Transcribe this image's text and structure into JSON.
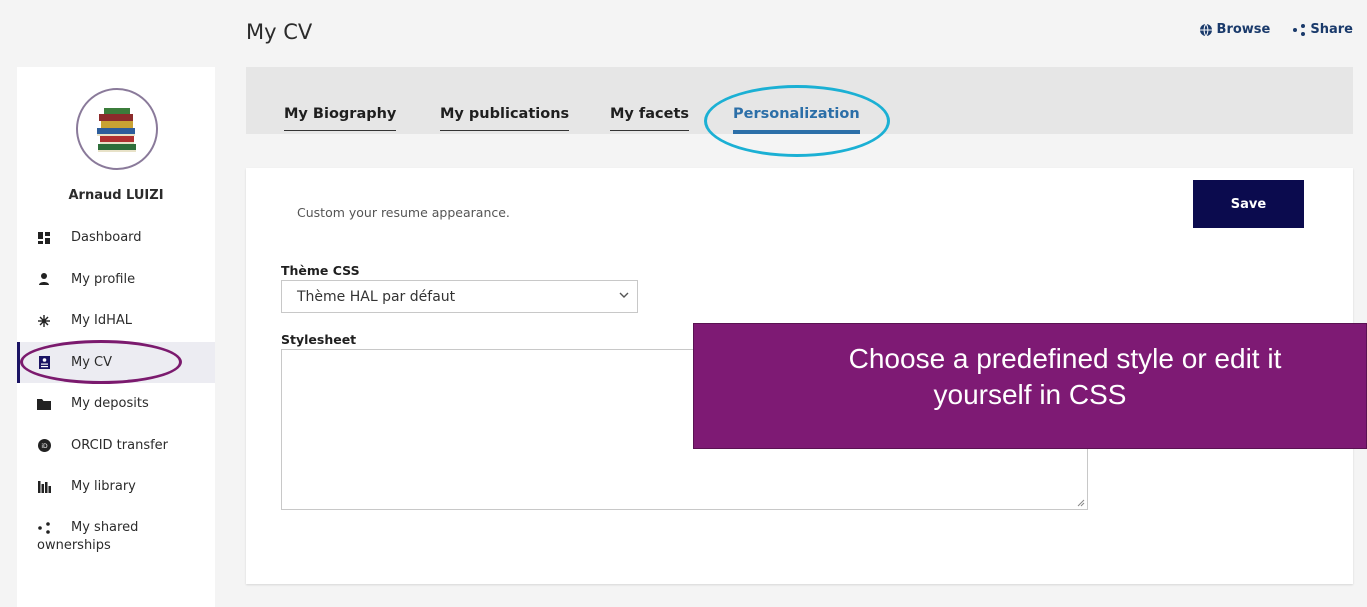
{
  "page": {
    "title": "My CV"
  },
  "top_actions": [
    {
      "label": "Browse",
      "icon": "globe-icon"
    },
    {
      "label": "Share",
      "icon": "share-icon"
    }
  ],
  "user": {
    "name": "Arnaud LUIZI",
    "avatar_icon": "books-icon"
  },
  "sidebar": {
    "items": [
      {
        "label": "Dashboard",
        "icon": "dashboard-icon"
      },
      {
        "label": "My profile",
        "icon": "person-icon"
      },
      {
        "label": "My IdHAL",
        "icon": "idhal-icon"
      },
      {
        "label": "My CV",
        "icon": "cv-icon",
        "active": true
      },
      {
        "label": "My deposits",
        "icon": "folder-icon"
      },
      {
        "label": "ORCID transfer",
        "icon": "orcid-icon"
      },
      {
        "label": "My library",
        "icon": "library-icon"
      },
      {
        "label": "My shared ownerships",
        "icon": "share-icon"
      }
    ]
  },
  "tabs": [
    {
      "label": "My Biography"
    },
    {
      "label": "My publications"
    },
    {
      "label": "My facets"
    },
    {
      "label": "Personalization",
      "active": true
    }
  ],
  "card": {
    "description": "Custom your resume appearance.",
    "save_label": "Save",
    "theme_label": "Thème CSS",
    "theme_value": "Thème HAL par défaut",
    "stylesheet_label": "Stylesheet",
    "stylesheet_value": ""
  },
  "callout": {
    "line1": "Choose a predefined style or edit it",
    "line2": "yourself in CSS",
    "color": "#7e1a74"
  },
  "colors": {
    "accent_tab": "#2c6fa8",
    "save_button": "#0b0b4e",
    "highlight_tab": "#1bb0d4",
    "highlight_nav": "#7b1a6e"
  }
}
